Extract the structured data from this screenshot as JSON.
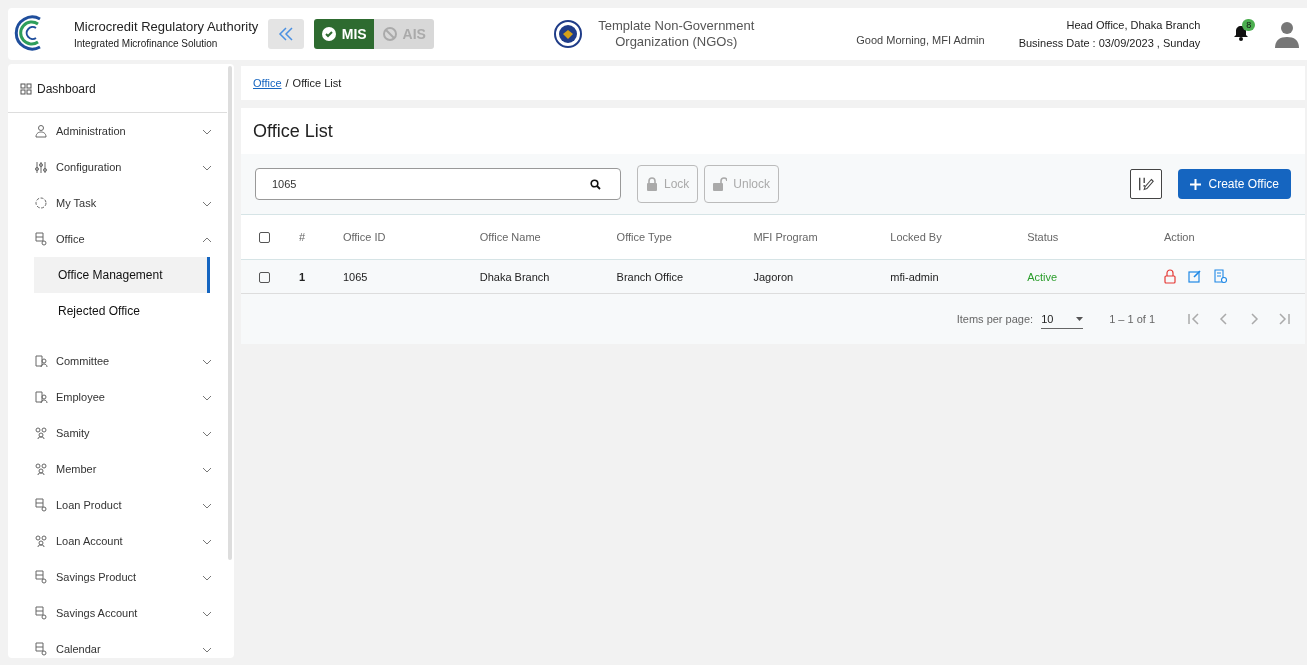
{
  "header": {
    "title": "Microcredit Regulatory Authority",
    "subtitle": "Integrated Microfinance Solution",
    "modes": [
      {
        "label": "MIS",
        "selected": true
      },
      {
        "label": "AIS",
        "selected": false
      }
    ],
    "organization": "Template Non-Government Organization (NGOs)",
    "greeting": "Good Morning, MFI Admin",
    "branch": "Head Office, Dhaka Branch",
    "business_date": "Business Date : 03/09/2023 , Sunday",
    "notification_count": "8"
  },
  "sidebar": {
    "dashboard": "Dashboard",
    "items": [
      {
        "label": "Administration",
        "expanded": false
      },
      {
        "label": "Configuration",
        "expanded": false
      },
      {
        "label": "My Task",
        "expanded": false
      },
      {
        "label": "Office",
        "expanded": true,
        "children": [
          {
            "label": "Office Management",
            "selected": true
          },
          {
            "label": "Rejected Office",
            "selected": false
          }
        ]
      },
      {
        "label": "Committee",
        "expanded": false
      },
      {
        "label": "Employee",
        "expanded": false
      },
      {
        "label": "Samity",
        "expanded": false
      },
      {
        "label": "Member",
        "expanded": false
      },
      {
        "label": "Loan Product",
        "expanded": false
      },
      {
        "label": "Loan Account",
        "expanded": false
      },
      {
        "label": "Savings Product",
        "expanded": false
      },
      {
        "label": "Savings Account",
        "expanded": false
      },
      {
        "label": "Calendar",
        "expanded": false
      }
    ]
  },
  "breadcrumb": [
    {
      "label": "Office",
      "kind": "link"
    },
    {
      "label": "/",
      "kind": "separator"
    },
    {
      "label": "Office List",
      "kind": "current"
    }
  ],
  "page_title": "Office List",
  "toolbar": {
    "search_value": "1065",
    "lock": "Lock",
    "unlock": "Unlock",
    "create": "Create Office"
  },
  "table": {
    "all_checked": false,
    "columns": [
      "#",
      "Office ID",
      "Office Name",
      "Office Type",
      "MFI Program",
      "Locked By",
      "Status",
      "Action"
    ],
    "rows": [
      {
        "checked": false,
        "cells": [
          "1",
          "1065",
          "Dhaka Branch",
          "Branch Office",
          "Jagoron",
          "mfi-admin",
          "Active"
        ]
      }
    ]
  },
  "paginator": {
    "label": "Items per page:",
    "page_size": "10",
    "range": "1 – 1 of 1"
  }
}
